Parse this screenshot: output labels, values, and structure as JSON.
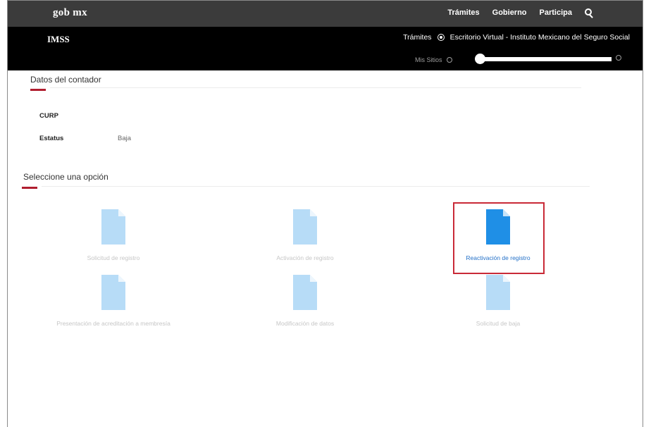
{
  "header": {
    "brand": "gob mx",
    "nav": [
      "Trámites",
      "Gobierno",
      "Participa"
    ],
    "search_icon": "search-icon"
  },
  "subheader": {
    "site": "IMSS",
    "breadcrumb_1": "Trámites",
    "breadcrumb_2": "Escritorio Virtual - Instituto Mexicano del Seguro Social",
    "mis_sitios": "Mis Sitios"
  },
  "contador": {
    "title": "Datos del contador",
    "curp_label": "CURP",
    "curp_value": "",
    "estatus_label": "Estatus",
    "estatus_value": "Baja"
  },
  "opciones": {
    "title": "Seleccione una opción",
    "items": [
      {
        "label": "Solicitud de registro",
        "active": false
      },
      {
        "label": "Activación de registro",
        "active": false
      },
      {
        "label": "Reactivación de registro",
        "active": true
      },
      {
        "label": "Presentación de acreditación a membresía",
        "active": false
      },
      {
        "label": "Modificación de datos",
        "active": false
      },
      {
        "label": "Solicitud de baja",
        "active": false
      }
    ]
  },
  "colors": {
    "doc_active": "#1f8fe6",
    "doc_inactive": "#b7dcf7",
    "accent_red": "#b01e2f"
  }
}
